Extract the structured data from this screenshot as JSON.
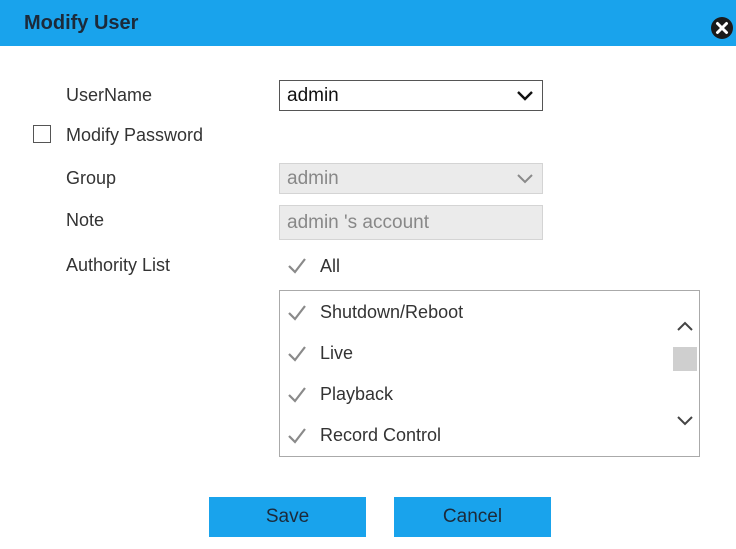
{
  "dialog": {
    "title": "Modify User"
  },
  "form": {
    "username_label": "UserName",
    "username_value": "admin",
    "modify_password_label": "Modify Password",
    "modify_password_checked": false,
    "group_label": "Group",
    "group_value": "admin",
    "note_label": "Note",
    "note_value": "admin 's account",
    "authority_label": "Authority List",
    "all_label": "All",
    "all_checked": true
  },
  "authority_items": [
    {
      "label": "Shutdown/Reboot",
      "checked": true
    },
    {
      "label": "Live",
      "checked": true
    },
    {
      "label": "Playback",
      "checked": true
    },
    {
      "label": "Record Control",
      "checked": true
    }
  ],
  "buttons": {
    "save": "Save",
    "cancel": "Cancel"
  },
  "colors": {
    "accent": "#19a3ec",
    "disabled_bg": "#ebebeb"
  },
  "icons": {
    "close": "close-icon",
    "chevron": "chevron-down-icon",
    "check": "check-icon",
    "scroll_up": "chevron-up-icon",
    "scroll_down": "chevron-down-icon"
  }
}
